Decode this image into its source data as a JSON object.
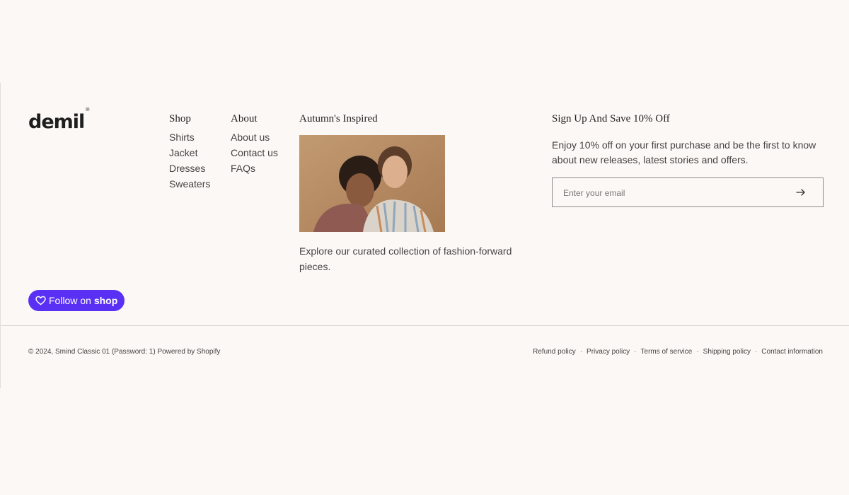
{
  "brand": {
    "logo": "demil",
    "logo_mark": "®"
  },
  "nav": {
    "shop": {
      "heading": "Shop",
      "links": [
        "Shirts",
        "Jacket",
        "Dresses",
        "Sweaters"
      ]
    },
    "about": {
      "heading": "About",
      "links": [
        "About us",
        "Contact us",
        "FAQs"
      ]
    }
  },
  "feature": {
    "heading": "Autumn's Inspired",
    "text": "Explore our curated collection of fashion-forward pieces."
  },
  "signup": {
    "heading": "Sign Up And Save 10% Off",
    "text": "Enjoy 10% off on your first purchase and be the first to know about new releases, latest stories and offers.",
    "email_placeholder": "Enter your email"
  },
  "follow": {
    "label": "Follow on",
    "brand": "shop"
  },
  "footer_bottom": {
    "copyright": "© 2024, Smind Classic 01 (Password: 1) Powered by Shopify",
    "policies": [
      "Refund policy",
      "Privacy policy",
      "Terms of service",
      "Shipping policy",
      "Contact information"
    ]
  },
  "colors": {
    "background": "#fcf8f5",
    "follow_button": "#5a31f4",
    "text": "#3a3a3a"
  },
  "icons": {
    "submit": "arrow-right-icon",
    "follow": "heart-icon"
  }
}
